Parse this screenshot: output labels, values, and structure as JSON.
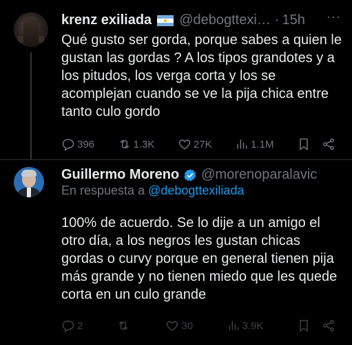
{
  "tweets": [
    {
      "author_name": "krenz exiliada",
      "handle": "@debogttexi…",
      "separator": "·",
      "time": "15h",
      "text": "Qué gusto ser gorda, porque sabes a quien le gustan las gordas ? A los tipos grandotes y a los pitudos, los verga corta y los se acomplejan cuando se ve la pija chica entre tanto culo gordo",
      "stats": {
        "replies": "396",
        "reposts": "1.3K",
        "likes": "27K",
        "views": "1.1M"
      }
    },
    {
      "author_name": "Guillermo Moreno",
      "handle": "@morenoparalavic",
      "reply_prefix": "En respuesta a",
      "reply_to": "@debogttexiliada",
      "text": "100% de acuerdo. Se lo dije a un amigo el otro día, a los negros les gustan chicas gordas o curvy porque en general tienen pija más grande y no tienen miedo que les quede corta en un culo grande",
      "stats": {
        "replies": "2",
        "reposts": "",
        "likes": "30",
        "views": "3.9K"
      }
    }
  ],
  "colors": {
    "background": "#000000",
    "text": "#e7e9ea",
    "muted": "#71767b",
    "accent": "#1d9bf0"
  },
  "icons": [
    "reply-icon",
    "repost-icon",
    "like-icon",
    "views-icon",
    "bookmark-icon",
    "share-icon",
    "verified-badge-icon",
    "more-icon",
    "argentina-flag-icon"
  ]
}
